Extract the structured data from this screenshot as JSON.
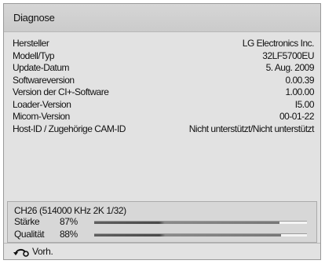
{
  "title": "Diagnose",
  "info_rows": [
    {
      "label": "Hersteller",
      "value": "LG Electronics Inc."
    },
    {
      "label": "Modell/Typ",
      "value": "32LF5700EU"
    },
    {
      "label": "Update-Datum",
      "value": "5. Aug. 2009"
    },
    {
      "label": "Softwareversion",
      "value": "0.00.39"
    },
    {
      "label": "Version der CI+-Software",
      "value": "1.00.00"
    },
    {
      "label": "Loader-Version",
      "value": "I5.00"
    },
    {
      "label": "Micom-Version",
      "value": "00-01-22"
    },
    {
      "label": "Host-ID / Zugehörige CAM-ID",
      "value": "Nicht unterstützt/Nicht unterstützt"
    }
  ],
  "signal": {
    "channel": "CH26 (514000 KHz 2K 1/32)",
    "strength": {
      "label": "Stärke",
      "percent_text": "87%",
      "level": 0.87
    },
    "quality": {
      "label": "Qualität",
      "percent_text": "88%",
      "level": 0.88
    }
  },
  "footer": {
    "back_label": "Vorh.",
    "back_icon": "return-arrow-icon"
  }
}
